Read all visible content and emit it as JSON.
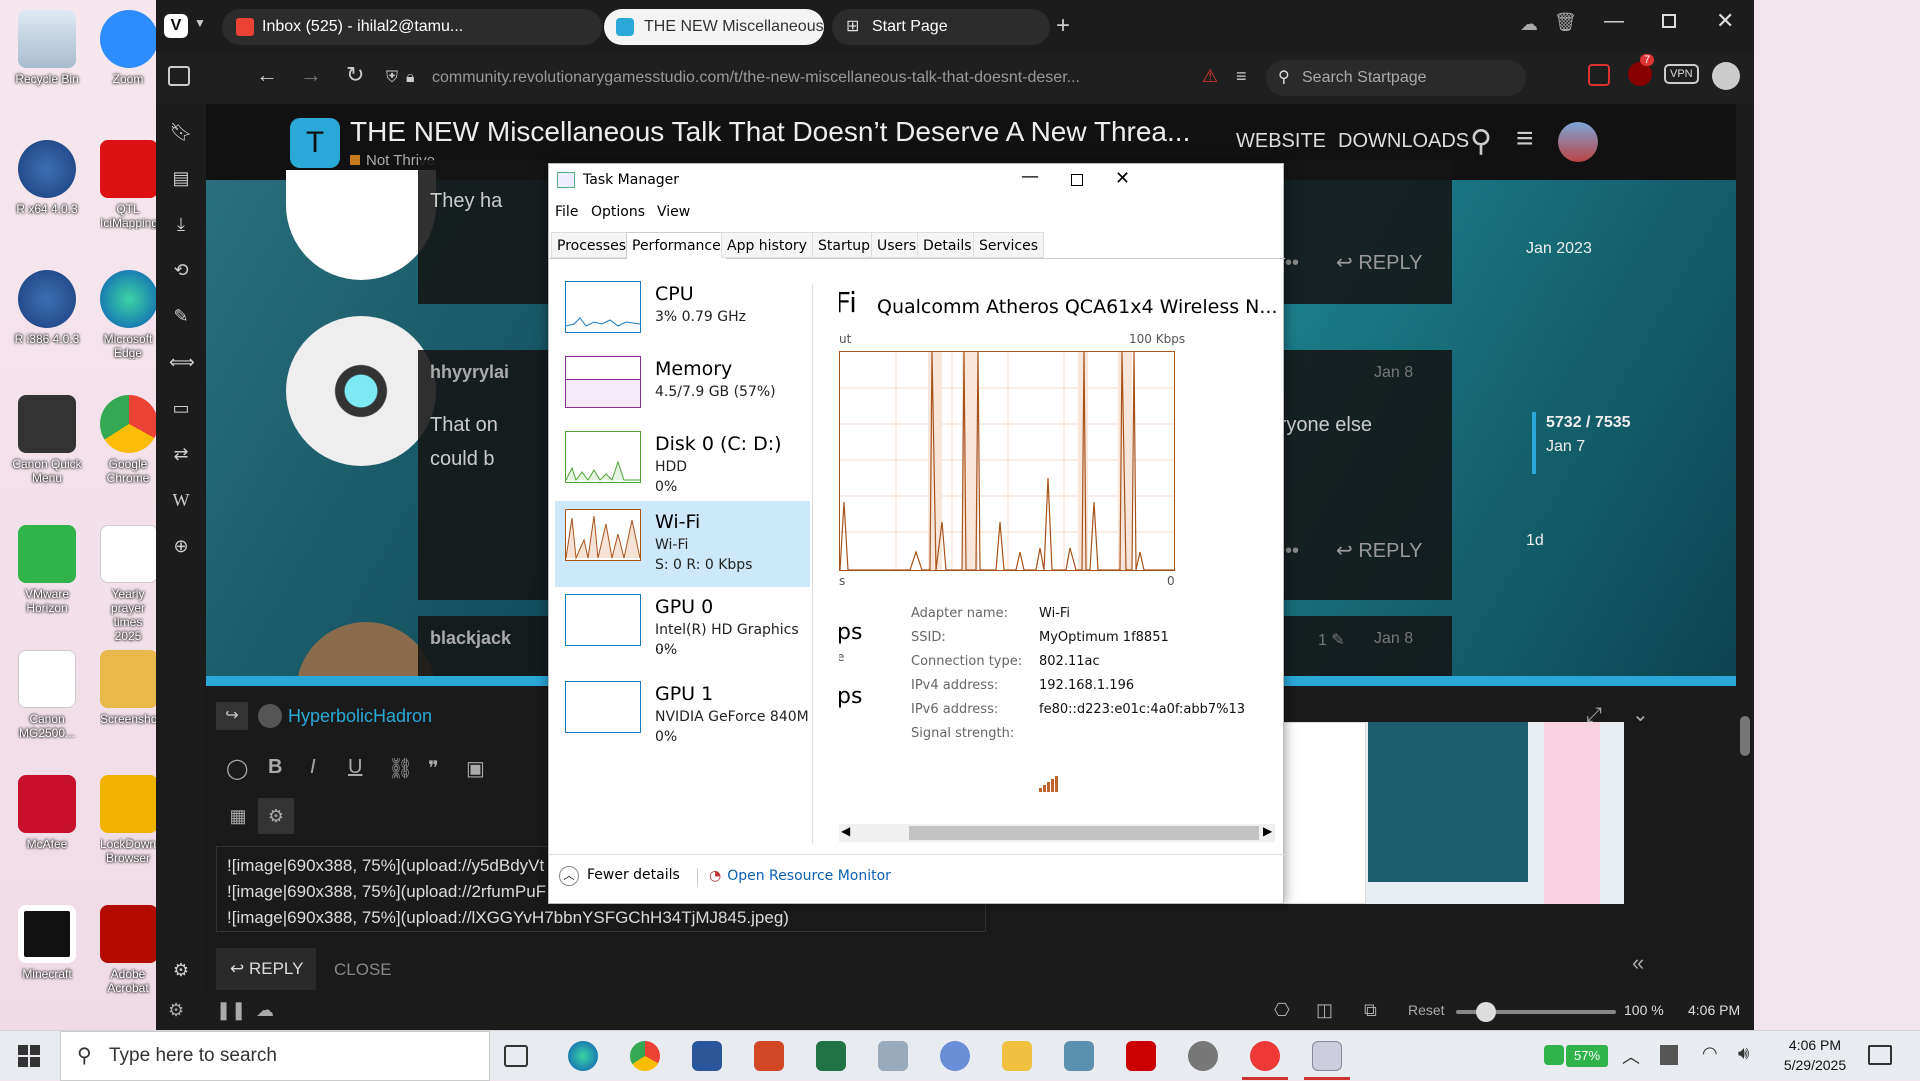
{
  "desktop": {
    "icons": [
      {
        "label": "Recycle Bin"
      },
      {
        "label": "Zoom"
      },
      {
        "label": "R x64 4.0.3"
      },
      {
        "label": "QTL IciMapping"
      },
      {
        "label": "R i386 4.0.3"
      },
      {
        "label": "Microsoft Edge"
      },
      {
        "label": "Canon Quick Menu"
      },
      {
        "label": "Google Chrome"
      },
      {
        "label": "VMware Horizon"
      },
      {
        "label": "Yearly prayer times 2025"
      },
      {
        "label": "Canon MG2500..."
      },
      {
        "label": "Screenshots"
      },
      {
        "label": "McAfee"
      },
      {
        "label": "LockDown Browser"
      },
      {
        "label": "Minecraft"
      },
      {
        "label": "Adobe Acrobat"
      }
    ]
  },
  "browser": {
    "tabs": [
      {
        "label": "Inbox (525) - ihilal2@tamu..."
      },
      {
        "label": "THE NEW Miscellaneous Ta"
      },
      {
        "label": "Start Page"
      }
    ],
    "url": "community.revolutionarygamesstudio.com/t/the-new-miscellaneous-talk-that-doesnt-deser...",
    "search_placeholder": "Search Startpage",
    "vpn": "VPN",
    "badge": "7",
    "status": {
      "reset": "Reset",
      "zoom": "100 %",
      "time": "4:06 PM"
    }
  },
  "forum": {
    "title": "THE NEW Miscellaneous Talk That Doesn’t Deserve A New Threa...",
    "category": "Not Thrive",
    "nav": [
      "WEBSITE",
      "DOWNLOADS"
    ],
    "posts": [
      {
        "user": "",
        "text": "They ha",
        "date": "",
        "action": "REPLY"
      },
      {
        "user": "hhyyrylai",
        "text": "That on",
        "text2": "could b",
        "tail": "U). Everyone else",
        "date": "Jan 8",
        "action": "REPLY"
      },
      {
        "user": "blackjack",
        "edits": "1",
        "date": "Jan 8"
      }
    ],
    "timeline": {
      "top": "Jan 2023",
      "position": "5732 / 7535",
      "current": "Jan 7",
      "bottom": "1d"
    },
    "composer": {
      "reply_to": "HyperbolicHadron",
      "lines": [
        "![image|690x388, 75%](upload://y5dBdyVt",
        "![image|690x388, 75%](upload://2rfumPuF",
        "![image|690x388, 75%](upload://lXGGYvH7bbnYSFGChH34TjMJ845.jpeg)"
      ],
      "reply": "REPLY",
      "close": "CLOSE"
    }
  },
  "taskmanager": {
    "title": "Task Manager",
    "menu": [
      "File",
      "Options",
      "View"
    ],
    "tabs": [
      "Processes",
      "Performance",
      "App history",
      "Startup",
      "Users",
      "Details",
      "Services"
    ],
    "active_tab": "Performance",
    "items": [
      {
        "name": "CPU",
        "l1": "3% 0.79 GHz",
        "l2": ""
      },
      {
        "name": "Memory",
        "l1": "4.5/7.9 GB (57%)",
        "l2": ""
      },
      {
        "name": "Disk 0 (C: D:)",
        "l1": "HDD",
        "l2": "0%"
      },
      {
        "name": "Wi-Fi",
        "l1": "Wi-Fi",
        "l2": "S: 0 R: 0 Kbps"
      },
      {
        "name": "GPU 0",
        "l1": "Intel(R) HD Graphics ...",
        "l2": "0%"
      },
      {
        "name": "GPU 1",
        "l1": "NVIDIA GeForce 840M",
        "l2": "0%"
      }
    ],
    "detail": {
      "heading": "Fi",
      "adapter_title": "Qualcomm Atheros QCA61x4 Wireless N...",
      "graph_top_left": "ut",
      "graph_max": "100 Kbps",
      "graph_bottom_left": "s",
      "graph_bottom_right": "0",
      "left_partial1": "ps",
      "left_partial2": "ps",
      "left_partial_mid": "e",
      "props": [
        {
          "k": "Adapter name:",
          "v": "Wi-Fi"
        },
        {
          "k": "SSID:",
          "v": "MyOptimum 1f8851"
        },
        {
          "k": "Connection type:",
          "v": "802.11ac"
        },
        {
          "k": "IPv4 address:",
          "v": "192.168.1.196"
        },
        {
          "k": "IPv6 address:",
          "v": "fe80::d223:e01c:4a0f:abb7%13"
        },
        {
          "k": "Signal strength:",
          "v": ""
        }
      ]
    },
    "fewer_details": "Fewer details",
    "resource_monitor": "Open Resource Monitor",
    "accent": "#c0622b"
  },
  "taskbar": {
    "search_placeholder": "Type here to search",
    "battery": "57%",
    "time": "4:06 PM",
    "date": "5/29/2025"
  }
}
